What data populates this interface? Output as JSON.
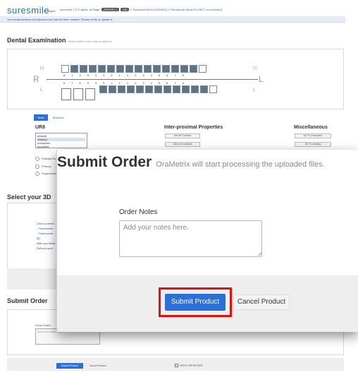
{
  "header": {
    "logo": "suresmile",
    "version": "7.0.alpha",
    "crumb_1": "suresmile 7 (7.0 alpha, at Stage",
    "pill": "(PERSP) 1",
    "pill2": "IIIB",
    "crumb_2": "Standard DePIn (C000001)",
    "crumb_3": "Therapeutic Model 5 (CBCT, not ordered)"
  },
  "alert": "Your email address (dev@mail.com) has not been verified. Please verify or update it.",
  "dental": {
    "title": "Dental Examination",
    "hint": "Click a tooth in the chart to select it.",
    "upper_label": "U",
    "lower_label": "L",
    "right_label": "R",
    "left_label": "L",
    "upper_nums": [
      "8",
      "7",
      "6",
      "5",
      "4",
      "3",
      "2",
      "1",
      "1",
      "2",
      "3",
      "4",
      "5",
      "6",
      "7",
      "8"
    ],
    "lower_nums": [
      "8",
      "7",
      "6",
      "5",
      "4",
      "3",
      "2",
      "1",
      "1",
      "2",
      "3",
      "4",
      "5",
      "6",
      "7",
      "8"
    ]
  },
  "tabs": {
    "teeth": "Teeth",
    "brackets": "Brackets"
  },
  "ur8": {
    "title": "UR8",
    "options": [
      "present",
      "missing",
      "unerupted",
      "impacted"
    ],
    "radios": [
      "Partially Erupted",
      "Primary",
      "Supernumerary"
    ]
  },
  "inter": {
    "title": "Inter-proximal Properties",
    "btn1": "Set all Contacts",
    "btn2": "Clear all Contacts"
  },
  "misc": {
    "title": "Miscellaneous",
    "btn1": "All 7's Unerupted",
    "btn2": "All 7's missing"
  },
  "select3d": {
    "title": "Select your 3D",
    "lines": [
      "Click to select",
      "- Fluorescein",
      "- Fluorescein 3D",
      "After you finish",
      "Refresh your"
    ]
  },
  "submit_section": {
    "title": "Submit Order",
    "notes_label": "Order Notes",
    "notes_placeholder": "Add your notes here.",
    "submit": "Submit Product",
    "cancel": "Cancel Product",
    "deliver": "Deliver with Brackets"
  },
  "modal": {
    "title": "Submit Order",
    "subtitle": "OraMetrix will start processing the uploaded files.",
    "notes_label": "Order Notes",
    "notes_placeholder": "Add your notes here.",
    "submit_button": "Submit Product",
    "cancel_button": "Cancel Product"
  },
  "colors": {
    "accent": "#2d6fd6",
    "highlight": "#e01010",
    "logo": "#2a6db0"
  }
}
